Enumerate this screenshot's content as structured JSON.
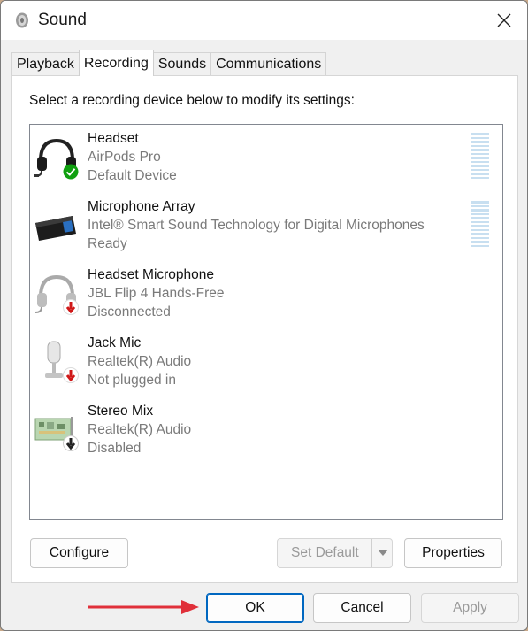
{
  "window": {
    "title": "Sound",
    "title_icon": "speaker-icon",
    "close_icon": "close-icon"
  },
  "tabs": [
    {
      "label": "Playback",
      "active": false
    },
    {
      "label": "Recording",
      "active": true
    },
    {
      "label": "Sounds",
      "active": false
    },
    {
      "label": "Communications",
      "active": false
    }
  ],
  "panel": {
    "instructions": "Select a recording device below to modify its settings:"
  },
  "devices": [
    {
      "name": "Headset",
      "subtitle": "AirPods Pro",
      "status": "Default Device",
      "icon": "headset-icon",
      "badge": "default-check-icon",
      "level_meter": true
    },
    {
      "name": "Microphone Array",
      "subtitle": "Intel® Smart Sound Technology for Digital Microphones",
      "status": "Ready",
      "icon": "microphone-array-icon",
      "badge": "",
      "level_meter": true
    },
    {
      "name": "Headset Microphone",
      "subtitle": "JBL Flip 4 Hands-Free",
      "status": "Disconnected",
      "icon": "headset-microphone-icon",
      "badge": "disconnected-arrow-icon",
      "level_meter": false
    },
    {
      "name": "Jack Mic",
      "subtitle": "Realtek(R) Audio",
      "status": "Not plugged in",
      "icon": "jack-mic-icon",
      "badge": "unplugged-arrow-icon",
      "level_meter": false
    },
    {
      "name": "Stereo Mix",
      "subtitle": "Realtek(R) Audio",
      "status": "Disabled",
      "icon": "sound-card-icon",
      "badge": "disabled-arrow-icon",
      "level_meter": false
    }
  ],
  "panel_buttons": {
    "configure": "Configure",
    "set_default": "Set Default",
    "properties": "Properties"
  },
  "dialog_buttons": {
    "ok": "OK",
    "cancel": "Cancel",
    "apply": "Apply"
  },
  "colors": {
    "badge_green": "#10a010",
    "badge_red": "#d01818",
    "annotation_arrow": "#e0303a",
    "accent": "#0067c0"
  }
}
